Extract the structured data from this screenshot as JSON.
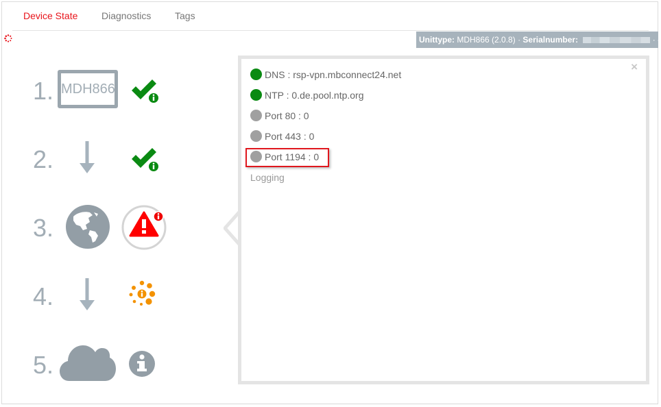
{
  "tabs": [
    {
      "label": "Device State",
      "active": true
    },
    {
      "label": "Diagnostics",
      "active": false
    },
    {
      "label": "Tags",
      "active": false
    }
  ],
  "infobar": {
    "unittype_label": "Unittype:",
    "unittype_value": "MDH866 (2.0.8)",
    "separator": "·",
    "serial_label": "Serialnumber:",
    "serial_value_redacted": true,
    "trailing": "· -"
  },
  "steps": [
    {
      "number": "1.",
      "item": "MDH866",
      "item_icon": "device-box",
      "status_icon": "check-info-icon",
      "status": "ok"
    },
    {
      "number": "2.",
      "item_icon": "arrow-down-icon",
      "status_icon": "check-info-icon",
      "status": "ok"
    },
    {
      "number": "3.",
      "item_icon": "globe-icon",
      "status_icon": "warning-info-icon",
      "status": "error",
      "selected": true
    },
    {
      "number": "4.",
      "item_icon": "arrow-down-icon",
      "status_icon": "loading-info-icon",
      "status": "pending"
    },
    {
      "number": "5.",
      "item_icon": "cloud-icon",
      "status_icon": "info-icon",
      "status": "unknown"
    }
  ],
  "panel": {
    "close_label": "×",
    "checks": [
      {
        "label": "DNS : rsp-vpn.mbconnect24.net",
        "status": "ok"
      },
      {
        "label": "NTP : 0.de.pool.ntp.org",
        "status": "ok"
      },
      {
        "label": "Port 80 : 0",
        "status": "none"
      },
      {
        "label": "Port 443 : 0",
        "status": "none"
      },
      {
        "label": "Port 1194 : 0",
        "status": "none",
        "highlighted": true
      }
    ],
    "logging_label": "Logging"
  },
  "colors": {
    "accent": "#e8141b",
    "ok": "#0a8a12",
    "neutral": "#a0a0a0",
    "icon_gray": "#9ba6ae",
    "warning_orange": "#f39200"
  }
}
